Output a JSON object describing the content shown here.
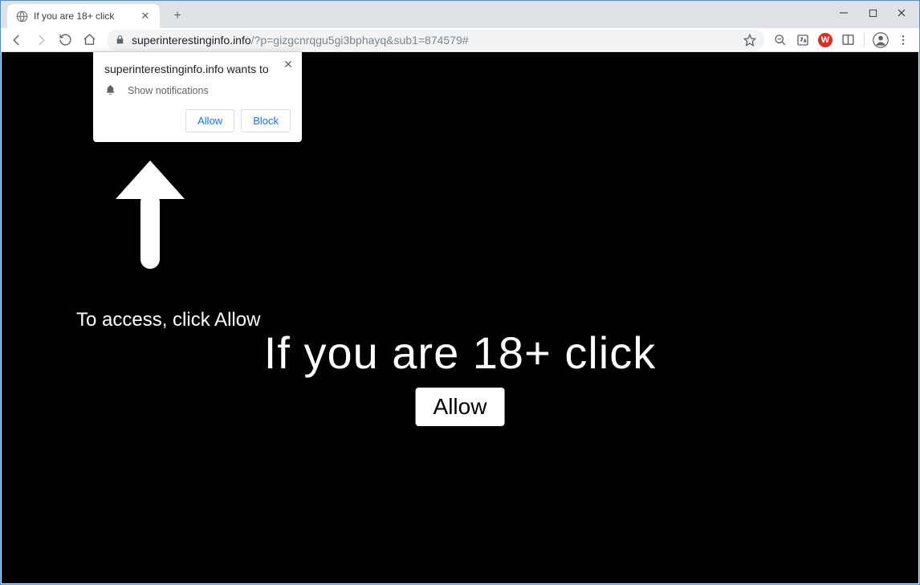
{
  "browser": {
    "tab": {
      "title": "If you are 18+ click"
    },
    "url": {
      "host": "superinterestinginfo.info",
      "path": "/?p=gizgcnrqgu5gi3bphayq&sub1=874579#"
    }
  },
  "notification_popup": {
    "prompt": "superinterestinginfo.info wants to",
    "permission_label": "Show notifications",
    "allow_label": "Allow",
    "block_label": "Block"
  },
  "page": {
    "caption": "To access, click Allow",
    "headline": "If you are 18+ click",
    "allow_button_label": "Allow"
  }
}
